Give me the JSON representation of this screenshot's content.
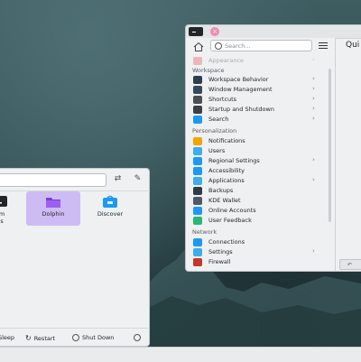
{
  "colors": {
    "wallpaper": "#2e4a4f",
    "panel_bg": "#eff0f1",
    "selected_tile": "#cdbcf3",
    "close_button": "#f08bb0"
  },
  "launcher": {
    "apps": [
      {
        "label": "em\ngs",
        "icon": "system-settings-icon",
        "selected": false
      },
      {
        "label": "Dolphin",
        "icon": "folder-icon",
        "selected": true
      },
      {
        "label": "Discover",
        "icon": "store-icon",
        "selected": false
      }
    ],
    "power": {
      "sleep": "Sleep",
      "restart": "Restart",
      "shutdown": "Shut Down"
    }
  },
  "settings": {
    "search_placeholder": "Search...",
    "content_title": "Qui",
    "items": [
      {
        "type": "item",
        "label": "Appearance",
        "icon": "appearance-icon",
        "chevron": true,
        "faded": true
      },
      {
        "type": "category",
        "label": "Workspace"
      },
      {
        "type": "item",
        "label": "Workspace Behavior",
        "icon": "workspace-icon",
        "chevron": true
      },
      {
        "type": "item",
        "label": "Window Management",
        "icon": "window-icon",
        "chevron": true
      },
      {
        "type": "item",
        "label": "Shortcuts",
        "icon": "keyboard-icon",
        "chevron": true
      },
      {
        "type": "item",
        "label": "Startup and Shutdown",
        "icon": "startup-icon",
        "chevron": true
      },
      {
        "type": "item",
        "label": "Search",
        "icon": "search-icon",
        "chevron": true
      },
      {
        "type": "category",
        "label": "Personalization"
      },
      {
        "type": "item",
        "label": "Notifications",
        "icon": "bell-icon",
        "chevron": false
      },
      {
        "type": "item",
        "label": "Users",
        "icon": "users-icon",
        "chevron": false
      },
      {
        "type": "item",
        "label": "Regional Settings",
        "icon": "regional-icon",
        "chevron": true
      },
      {
        "type": "item",
        "label": "Accessibility",
        "icon": "accessibility-icon",
        "chevron": false
      },
      {
        "type": "item",
        "label": "Applications",
        "icon": "applications-icon",
        "chevron": true
      },
      {
        "type": "item",
        "label": "Backups",
        "icon": "backups-icon",
        "chevron": false
      },
      {
        "type": "item",
        "label": "KDE Wallet",
        "icon": "wallet-icon",
        "chevron": false
      },
      {
        "type": "item",
        "label": "Online Accounts",
        "icon": "accounts-icon",
        "chevron": false
      },
      {
        "type": "item",
        "label": "User Feedback",
        "icon": "feedback-icon",
        "chevron": false
      },
      {
        "type": "category",
        "label": "Network"
      },
      {
        "type": "item",
        "label": "Connections",
        "icon": "connections-icon",
        "chevron": false
      },
      {
        "type": "item",
        "label": "Settings",
        "icon": "network-settings-icon",
        "chevron": true
      },
      {
        "type": "item",
        "label": "Firewall",
        "icon": "firewall-icon",
        "chevron": false
      }
    ]
  }
}
